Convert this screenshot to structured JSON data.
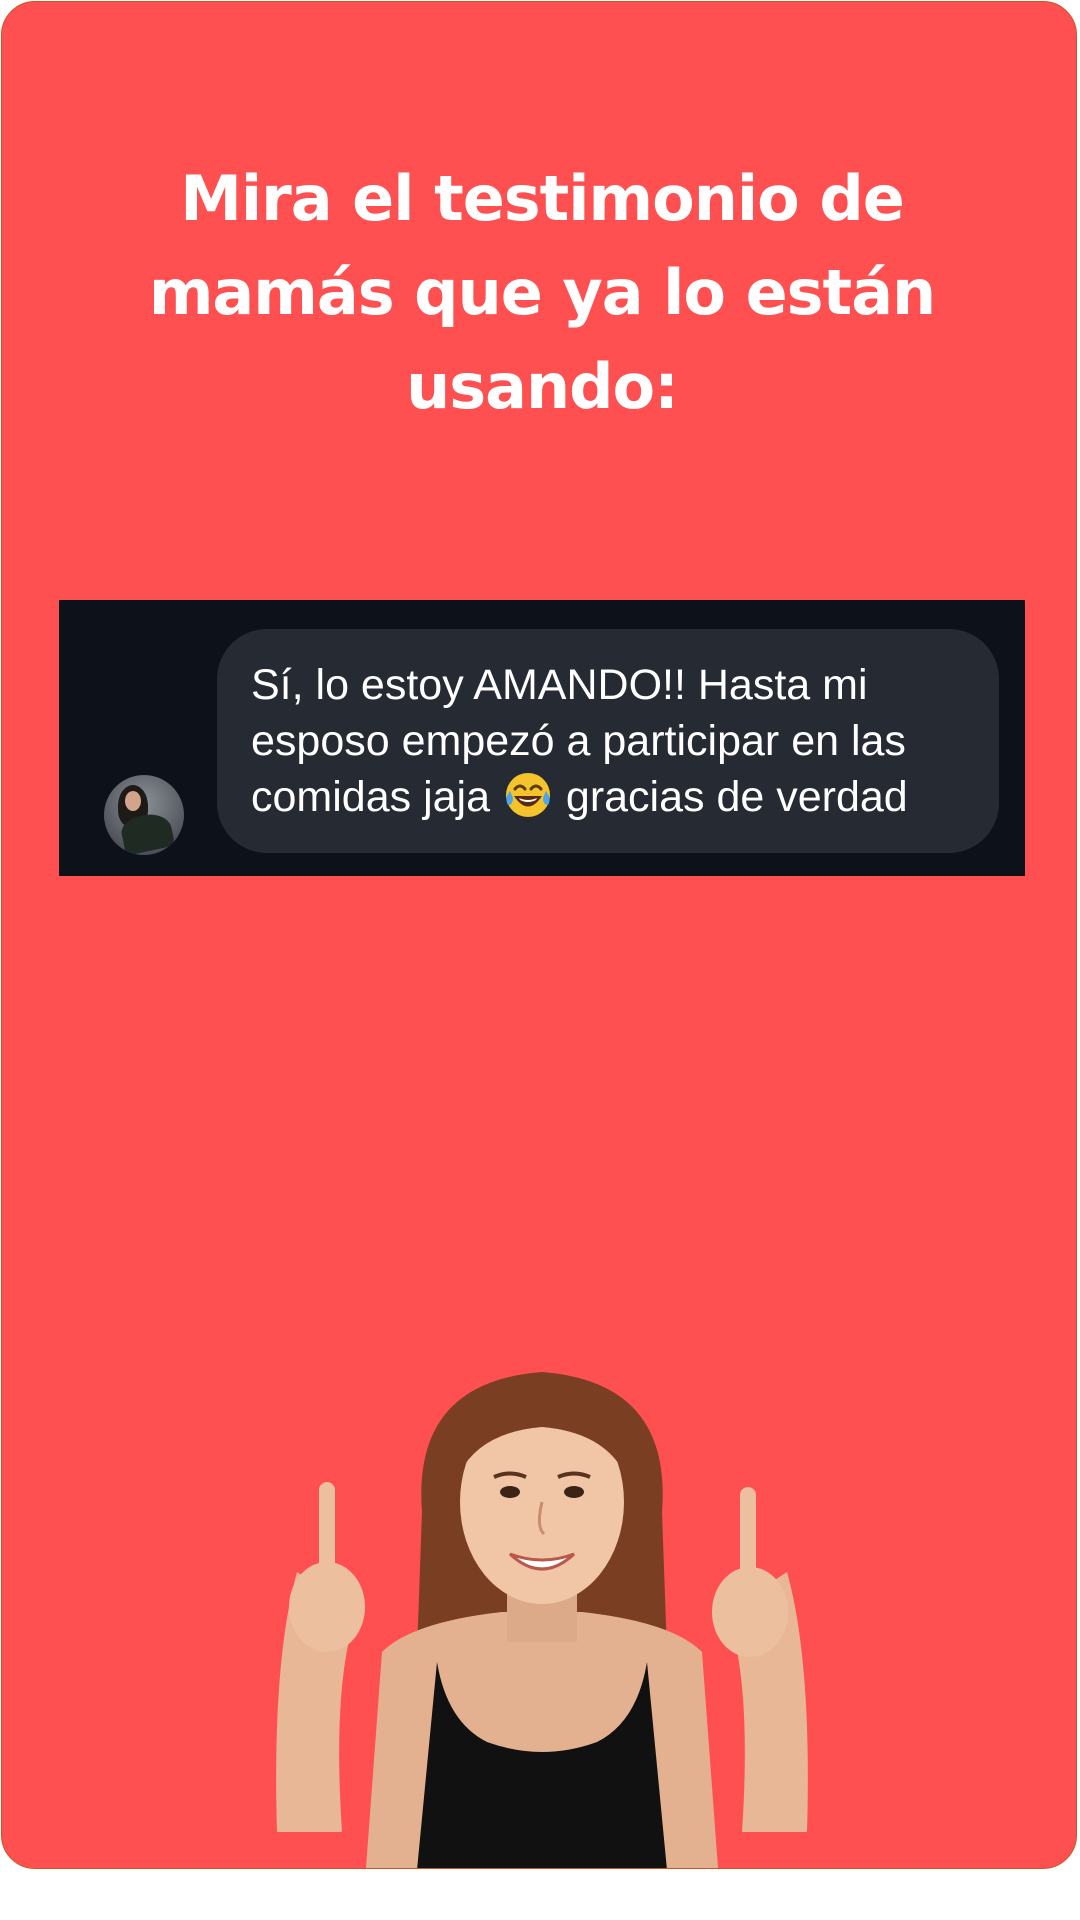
{
  "headline": "Mira el testimonio de mamás que ya lo están usando:",
  "testimonial": {
    "text_before_emoji": "Sí, lo estoy AMANDO!! Hasta mi\nesposo empezó a participar en las\ncomidas jaja ",
    "emoji": "face-with-tears-of-joy-icon",
    "text_after_emoji": " gracias de verdad",
    "avatar": "avatar"
  },
  "colors": {
    "background": "#fe5050",
    "border": "#c9561f",
    "chat_background": "#0d111a",
    "bubble": "#262a33",
    "text": "#ffffff"
  },
  "illustration": "smiling-woman-pointing-up"
}
